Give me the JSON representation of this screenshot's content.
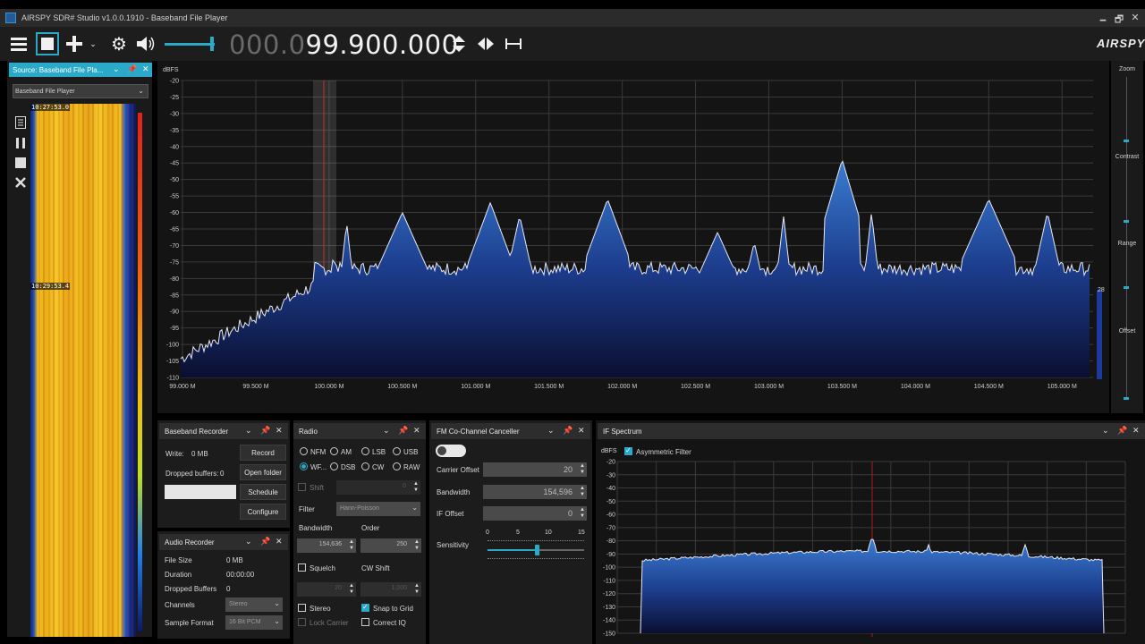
{
  "window": {
    "title": "AIRSPY SDR# Studio v1.0.0.1910 - Baseband File Player",
    "controls": [
      "🗕",
      "🗗",
      "✕"
    ]
  },
  "toolbar": {
    "frequency_dim": "000.0",
    "frequency_bright": "99.900.000",
    "logo": "AIRSPY"
  },
  "source": {
    "panel_title": "Source: Baseband File Pla...",
    "selected": "Baseband File Player",
    "timestamps": [
      "10:27:53.0",
      "10:29:53.4"
    ]
  },
  "spectrum": {
    "unit": "dBFS",
    "y_ticks": [
      "-20",
      "-25",
      "-30",
      "-35",
      "-40",
      "-45",
      "-50",
      "-55",
      "-60",
      "-65",
      "-70",
      "-75",
      "-80",
      "-85",
      "-90",
      "-95",
      "-100",
      "-105",
      "-110"
    ],
    "x_ticks": [
      "99.000 M",
      "99.500 M",
      "100.000 M",
      "100.500 M",
      "101.000 M",
      "101.500 M",
      "102.000 M",
      "102.500 M",
      "103.000 M",
      "103.500 M",
      "104.000 M",
      "104.500 M",
      "105.000 M"
    ],
    "side_value": "28"
  },
  "right_strip": {
    "zoom": "Zoom",
    "contrast": "Contrast",
    "range": "Range",
    "offset": "Offset"
  },
  "baseband_recorder": {
    "title": "Baseband Recorder",
    "write_label": "Write:",
    "write_value": "0 MB",
    "dropped_label": "Dropped buffers:",
    "dropped_value": "0",
    "record": "Record",
    "open_folder": "Open folder",
    "schedule": "Schedule",
    "configure": "Configure"
  },
  "audio_recorder": {
    "title": "Audio Recorder",
    "file_size_label": "File Size",
    "file_size": "0 MB",
    "duration_label": "Duration",
    "duration": "00:00:00",
    "dropped_label": "Dropped Buffers",
    "dropped": "0",
    "channels_label": "Channels",
    "channels": "Stereo",
    "format_label": "Sample Format",
    "format": "16 Bit PCM"
  },
  "radio": {
    "title": "Radio",
    "modes": [
      "NFM",
      "AM",
      "LSB",
      "USB",
      "WF...",
      "DSB",
      "CW",
      "RAW"
    ],
    "shift_label": "Shift",
    "shift_value": "0",
    "filter_label": "Filter",
    "filter_value": "Hann-Poisson",
    "bandwidth_label": "Bandwidth",
    "bandwidth_value": "154,636",
    "order_label": "Order",
    "order_value": "250",
    "squelch_label": "Squelch",
    "cwshift_label": "CW Shift",
    "squelch_value": "20",
    "cwshift_value": "1,000",
    "stereo_label": "Stereo",
    "snap_label": "Snap to Grid",
    "lockcarrier_label": "Lock Carrier",
    "correctiq_label": "Correct IQ"
  },
  "fm_canceller": {
    "title": "FM Co-Channel Canceller",
    "carrier_offset_label": "Carrier Offset",
    "carrier_offset": "20",
    "bandwidth_label": "Bandwidth",
    "bandwidth": "154,596",
    "if_offset_label": "IF Offset",
    "if_offset": "0",
    "sensitivity_label": "Sensitivity",
    "scale": [
      "0",
      "5",
      "10",
      "15"
    ]
  },
  "if_spectrum": {
    "title": "IF Spectrum",
    "unit": "dBFS",
    "asym_label": "Asymmetric Filter",
    "y_ticks": [
      "-20",
      "-30",
      "-40",
      "-50",
      "-60",
      "-70",
      "-80",
      "-90",
      "-100",
      "-110",
      "-120",
      "-130",
      "-140",
      "-150"
    ]
  }
}
